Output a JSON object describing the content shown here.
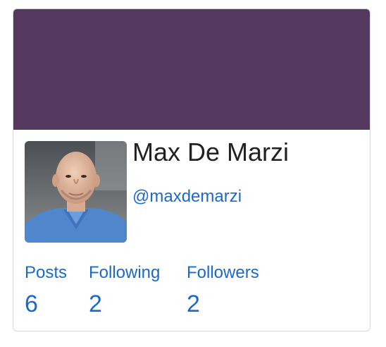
{
  "profile": {
    "name": "Max De Marzi",
    "handle": "@maxdemarzi",
    "banner_color": "#54385e",
    "link_color": "#1b6ac8"
  },
  "stats": [
    {
      "label": "Posts",
      "value": "6"
    },
    {
      "label": "Following",
      "value": "2"
    },
    {
      "label": "Followers",
      "value": "2"
    }
  ]
}
